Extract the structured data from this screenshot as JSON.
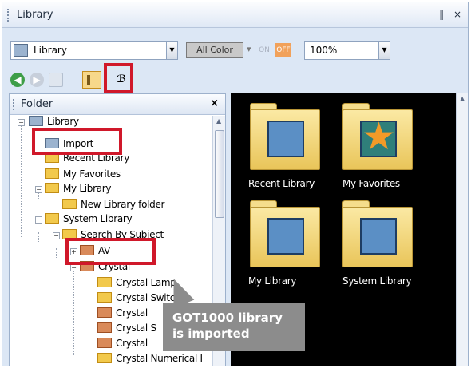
{
  "window": {
    "title": "Library",
    "pin_glyph": "‖",
    "close_glyph": "×"
  },
  "toolbar": {
    "library_combo": "Library",
    "color_filter": "All Color",
    "on_label": "ON",
    "off_label": "OFF",
    "zoom": "100%"
  },
  "folder_pane": {
    "title": "Folder",
    "close_glyph": "×",
    "tree": [
      {
        "label": "Library"
      },
      {
        "label": "Import"
      },
      {
        "label": "Recent Library"
      },
      {
        "label": "My Favorites"
      },
      {
        "label": "My Library"
      },
      {
        "label": "New Library folder"
      },
      {
        "label": "System Library"
      },
      {
        "label": "Search By Subject"
      },
      {
        "label": "AV"
      },
      {
        "label": "Crystal"
      },
      {
        "label": "Crystal Lamp"
      },
      {
        "label": "Crystal Switch"
      },
      {
        "label": "Crystal"
      },
      {
        "label": "Crystal S"
      },
      {
        "label": "Crystal"
      },
      {
        "label": "Crystal Numerical I"
      }
    ]
  },
  "library_view": {
    "items": [
      {
        "label": "Recent Library",
        "icon": "recent-library-icon"
      },
      {
        "label": "My Favorites",
        "icon": "favorites-star-icon"
      },
      {
        "label": "My Library",
        "icon": "my-library-heart-icon"
      },
      {
        "label": "System Library",
        "icon": "system-library-gear-icon"
      }
    ]
  },
  "callout": {
    "line1": "GOT1000 library",
    "line2": "is imported"
  },
  "colors": {
    "highlight": "#d0182a",
    "callout_bg": "#8c8c8c",
    "view_bg": "#000000"
  }
}
